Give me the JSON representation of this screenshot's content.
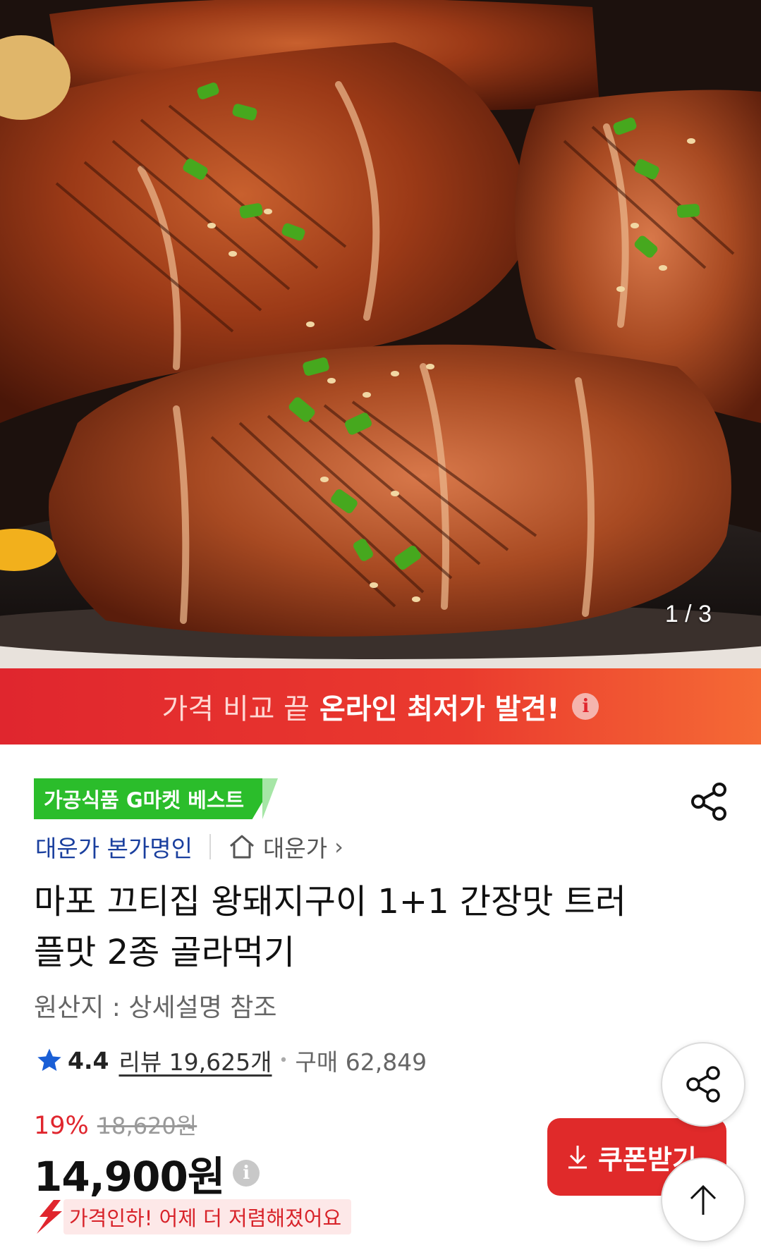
{
  "hero": {
    "image_description_name": "grilled-pork-product-photo",
    "page_indicator": "1 / 3"
  },
  "banner": {
    "text_light": "가격 비교 끝",
    "text_bold": "온라인 최저가 발견!",
    "info_glyph": "i"
  },
  "product": {
    "badge": "가공식품 G마켓 베스트",
    "seller_name": "대운가 본가명인",
    "store_name": "대운가",
    "store_chevron": "›",
    "title": "마포 끄티집 왕돼지구이 1+1 간장맛 트러플맛 2종 골라먹기",
    "origin": "원산지 : 상세설명 참조"
  },
  "rating": {
    "score": "4.4",
    "reviews": "리뷰 19,625개",
    "separator": "•",
    "purchases": "구매 62,849"
  },
  "price": {
    "discount_rate": "19%",
    "original_price": "18,620원",
    "sale_price": "14,900원",
    "info_glyph": "i",
    "price_drop_message": "가격인하! 어제 더 저렴해졌어요"
  },
  "actions": {
    "coupon_label": "쿠폰받기"
  },
  "colors": {
    "accent_red": "#e0262e",
    "badge_green": "#2bbd2b",
    "seller_blue": "#1a3f9e",
    "star_blue": "#1a5fd6"
  },
  "icons": [
    "share-icon",
    "home-icon",
    "star-icon",
    "info-icon",
    "download-icon",
    "arrow-up-icon",
    "price-drop-arrow-icon"
  ]
}
